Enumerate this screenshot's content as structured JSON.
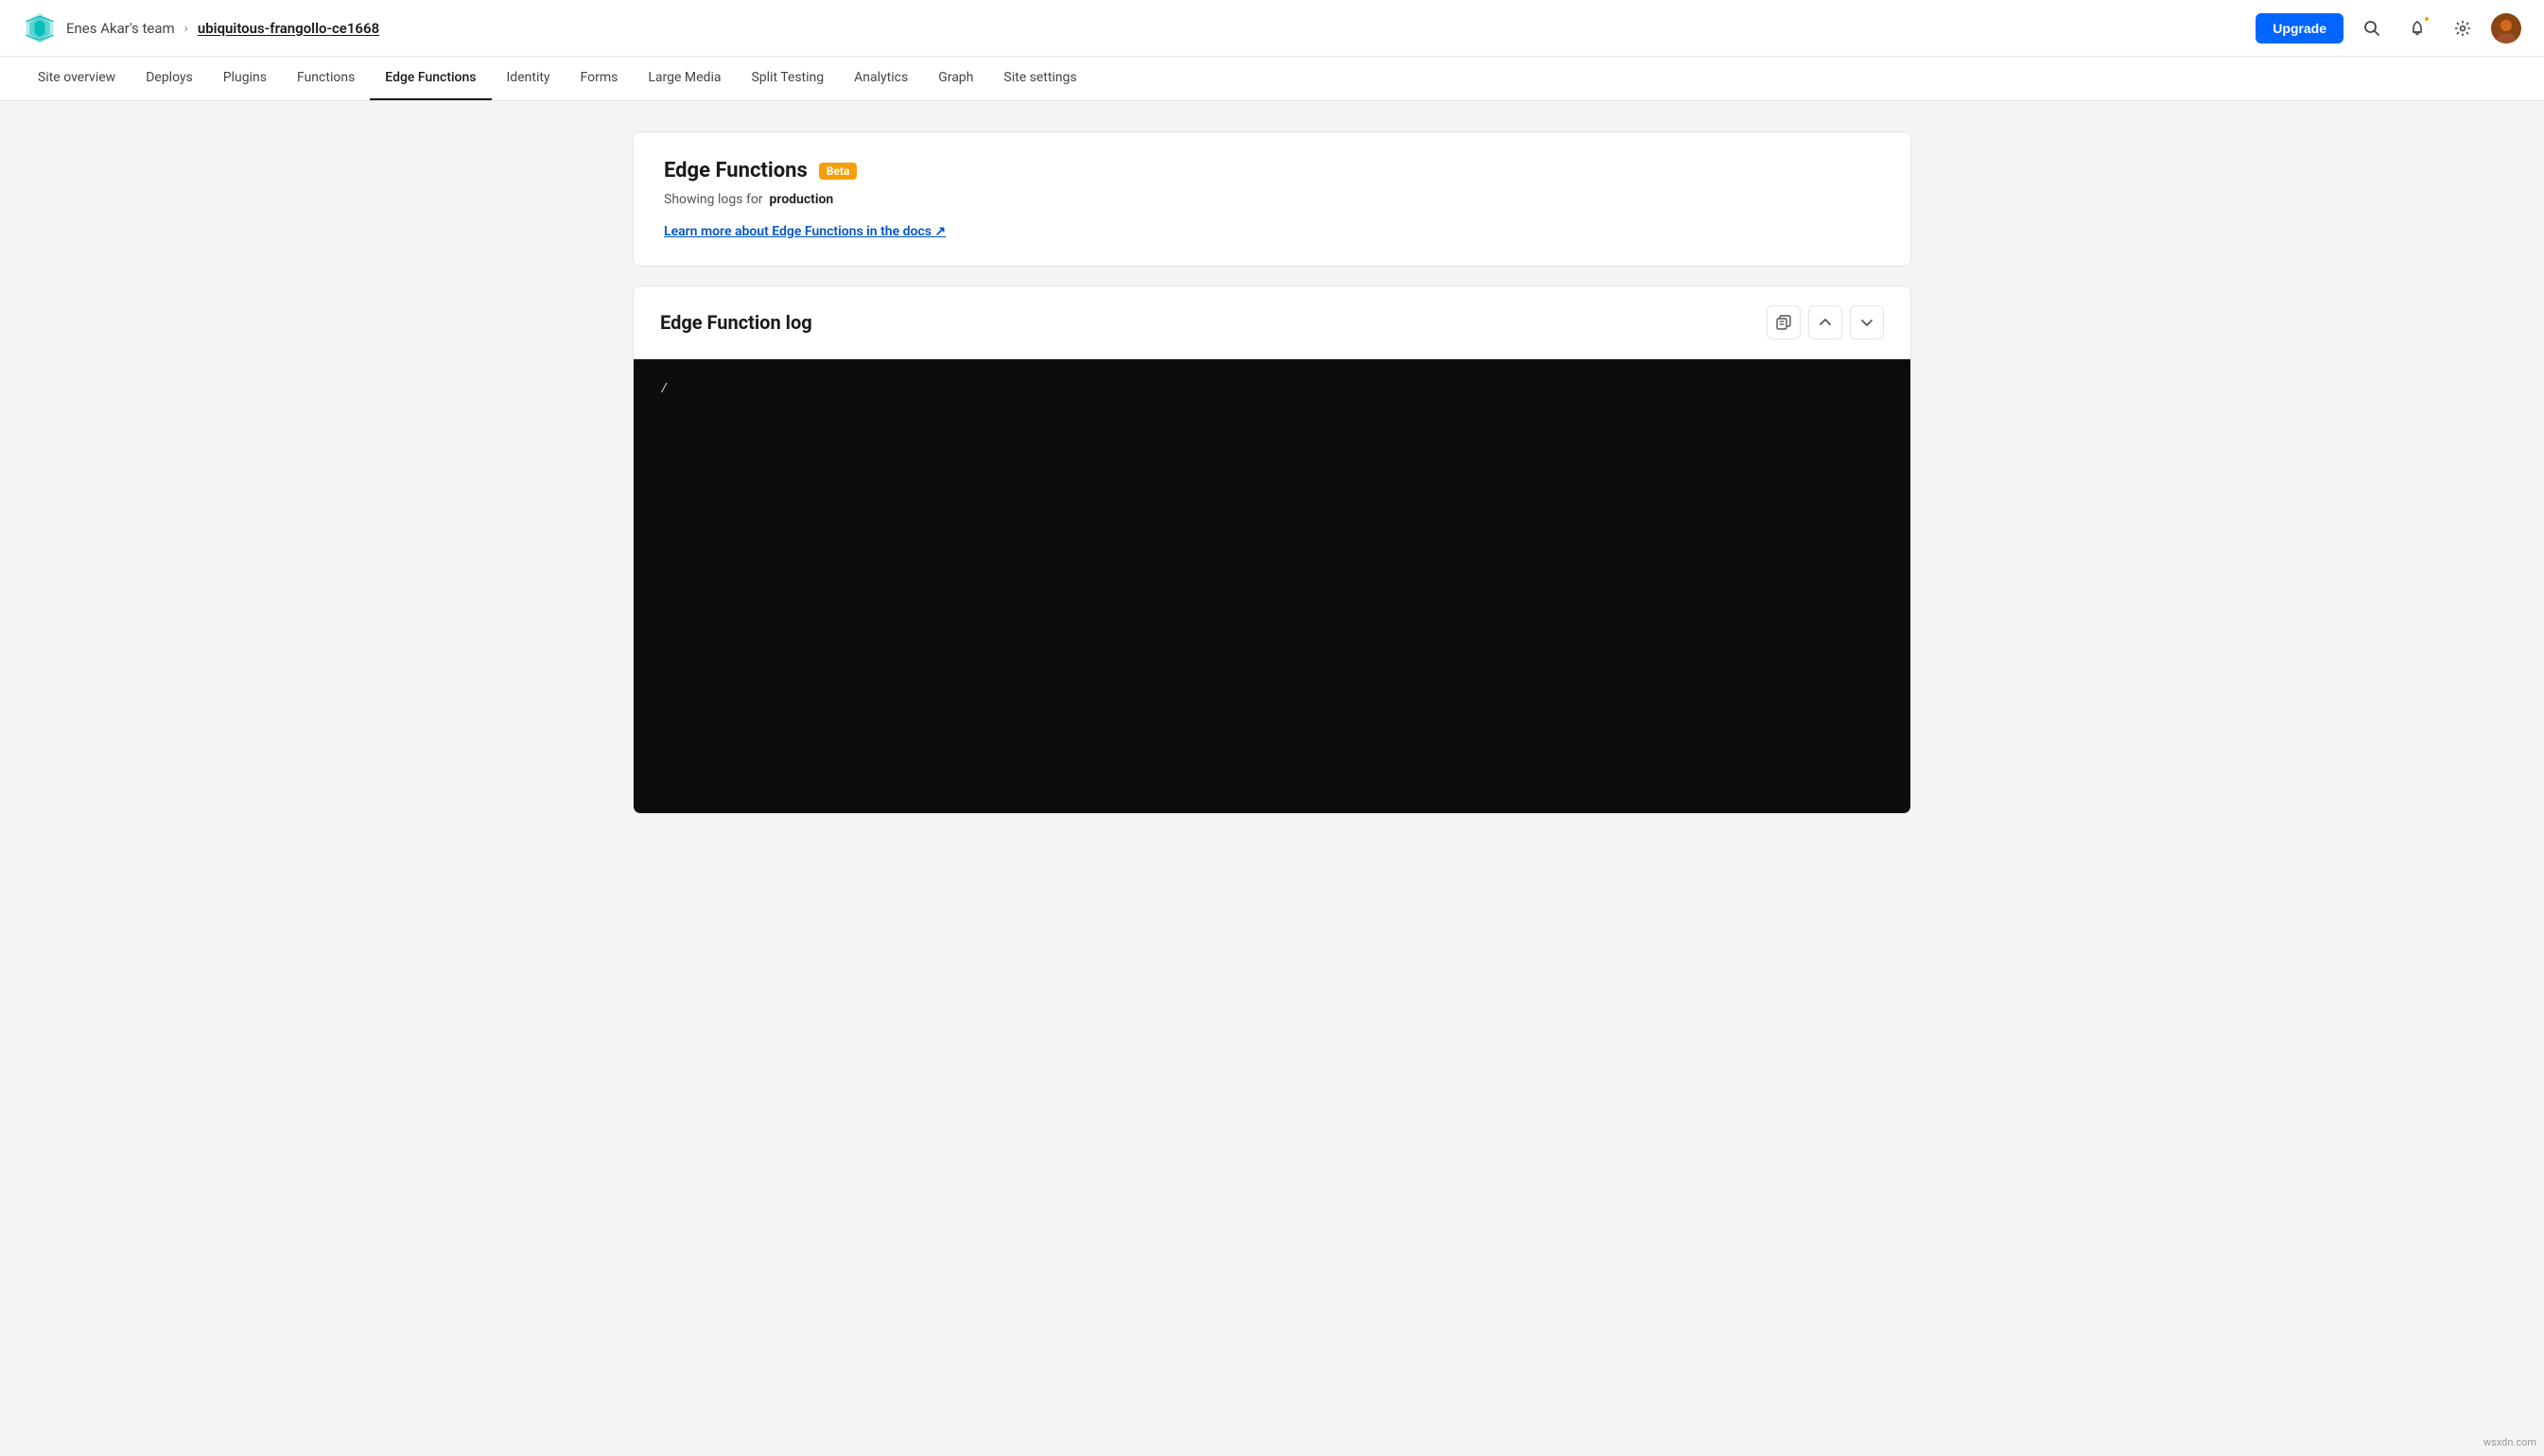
{
  "header": {
    "team_name": "Enes Akar's team",
    "breadcrumb_arrow": "›",
    "site_name": "ubiquitous-frangollo-ce1668",
    "upgrade_label": "Upgrade"
  },
  "nav": {
    "items": [
      {
        "id": "site-overview",
        "label": "Site overview",
        "active": false
      },
      {
        "id": "deploys",
        "label": "Deploys",
        "active": false
      },
      {
        "id": "plugins",
        "label": "Plugins",
        "active": false
      },
      {
        "id": "functions",
        "label": "Functions",
        "active": false
      },
      {
        "id": "edge-functions",
        "label": "Edge Functions",
        "active": true
      },
      {
        "id": "identity",
        "label": "Identity",
        "active": false
      },
      {
        "id": "forms",
        "label": "Forms",
        "active": false
      },
      {
        "id": "large-media",
        "label": "Large Media",
        "active": false
      },
      {
        "id": "split-testing",
        "label": "Split Testing",
        "active": false
      },
      {
        "id": "analytics",
        "label": "Analytics",
        "active": false
      },
      {
        "id": "graph",
        "label": "Graph",
        "active": false
      },
      {
        "id": "site-settings",
        "label": "Site settings",
        "active": false
      }
    ]
  },
  "info_card": {
    "title": "Edge Functions",
    "beta_badge": "Beta",
    "subtitle_prefix": "Showing logs for",
    "subtitle_env": "production",
    "docs_link_label": "Learn more about Edge Functions in the docs ↗"
  },
  "log_section": {
    "title": "Edge Function log",
    "log_content": "/",
    "controls": {
      "copy_icon": "⊞",
      "scroll_up_icon": "↑",
      "scroll_down_icon": "↓"
    }
  },
  "watermark": "wsxdn.com"
}
